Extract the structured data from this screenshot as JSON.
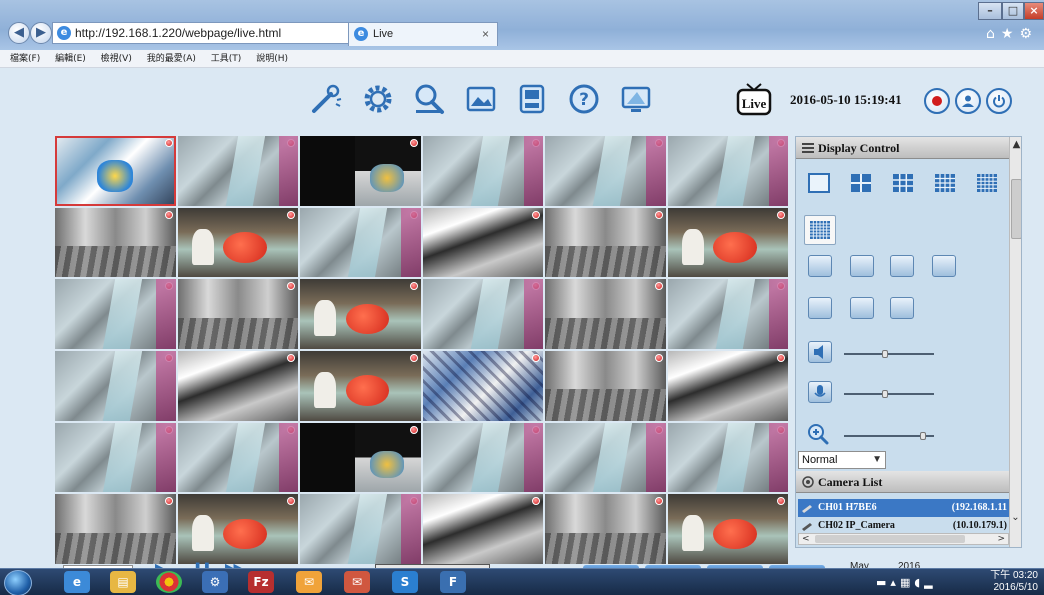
{
  "browser": {
    "url": "http://192.168.1.220/webpage/live.html",
    "address_tools": "⌕ ▾ ↻",
    "tab_title": "Live",
    "tab_close": "×",
    "menu": [
      "檔案(F)",
      "編輯(E)",
      "檢視(V)",
      "我的最愛(A)",
      "工具(T)",
      "說明(H)"
    ]
  },
  "app": {
    "live_label": "Live",
    "datetime": "2016-05-10 15:19:41",
    "toolbar_icons": [
      "tools-icon",
      "settings-gear-icon",
      "search-playback-icon",
      "image-icon",
      "backup-drive-icon",
      "help-icon",
      "monitor-icon"
    ],
    "grid": {
      "rows": 6,
      "columns": 6,
      "selected_cell": 0,
      "cells": [
        "g",
        "a",
        "f",
        "a",
        "a",
        "a",
        "c",
        "b",
        "a",
        "d",
        "c",
        "b",
        "a",
        "c",
        "b",
        "a",
        "c",
        "a",
        "a",
        "d",
        "b",
        "e",
        "c",
        "d",
        "a",
        "a",
        "f",
        "a",
        "a",
        "a",
        "c",
        "b",
        "a",
        "d",
        "c",
        "b"
      ]
    }
  },
  "panel": {
    "display_control_title": "Display Control",
    "display_mode": "Normal",
    "camera_list_title": "Camera List",
    "cameras": [
      {
        "name": "CH01 H7BE6",
        "ip": "(192.168.1.11",
        "selected": true
      },
      {
        "name": "CH02 IP_Camera",
        "ip": "(10.10.179.1)",
        "selected": false
      }
    ],
    "volume_level": 0.45,
    "mic_level": 0.45,
    "zoom_level": 0.9
  },
  "calendar": {
    "month": "May",
    "year": "2016"
  },
  "taskbar": {
    "clock_time": "下午 03:20",
    "clock_date": "2016/5/10"
  },
  "colors": {
    "app_bg": "#dbe8f3",
    "panel_bg": "#c9dded",
    "accent_blue": "#2f6fb5",
    "record_red": "#d11c1c",
    "selected_row": "#3b78c5"
  }
}
